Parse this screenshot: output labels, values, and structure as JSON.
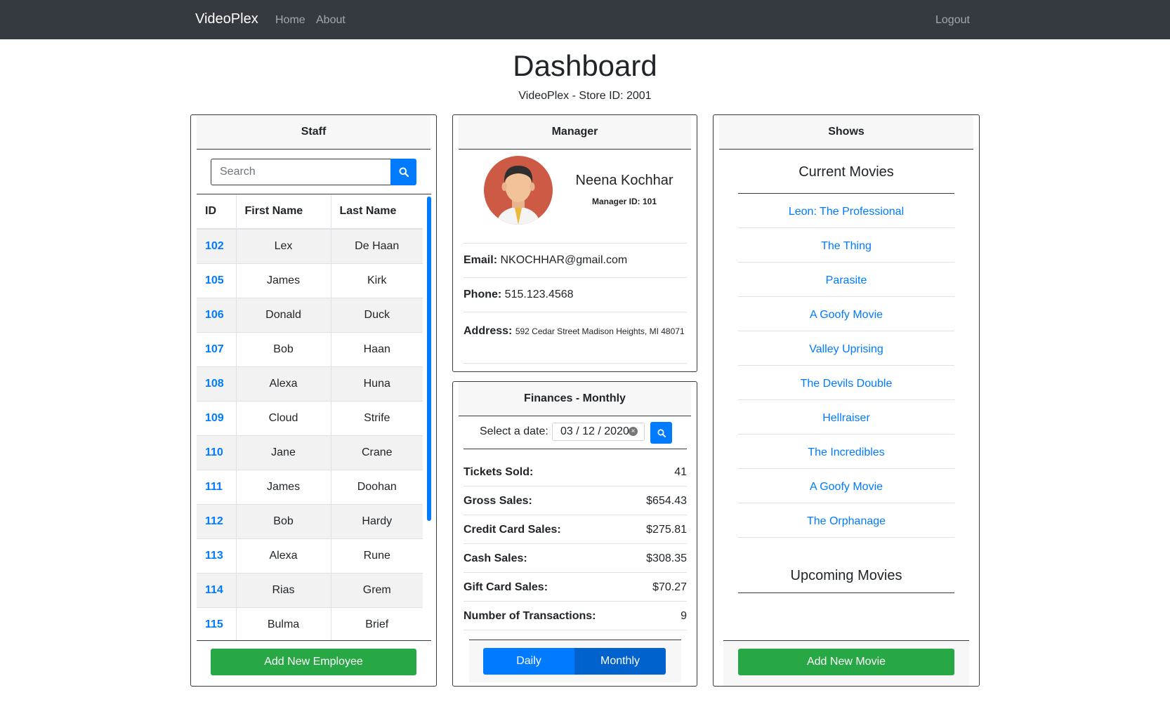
{
  "navbar": {
    "brand": "VideoPlex",
    "home": "Home",
    "about": "About",
    "logout": "Logout"
  },
  "page": {
    "title": "Dashboard",
    "subtitle": "VideoPlex - Store ID: 2001"
  },
  "staff": {
    "header": "Staff",
    "search_placeholder": "Search",
    "columns": [
      "ID",
      "First Name",
      "Last Name"
    ],
    "rows": [
      [
        "102",
        "Lex",
        "De Haan"
      ],
      [
        "105",
        "James",
        "Kirk"
      ],
      [
        "106",
        "Donald",
        "Duck"
      ],
      [
        "107",
        "Bob",
        "Haan"
      ],
      [
        "108",
        "Alexa",
        "Huna"
      ],
      [
        "109",
        "Cloud",
        "Strife"
      ],
      [
        "110",
        "Jane",
        "Crane"
      ],
      [
        "111",
        "James",
        "Doohan"
      ],
      [
        "112",
        "Bob",
        "Hardy"
      ],
      [
        "113",
        "Alexa",
        "Rune"
      ],
      [
        "114",
        "Rias",
        "Grem"
      ],
      [
        "115",
        "Bulma",
        "Brief"
      ]
    ],
    "add_button": "Add New Employee"
  },
  "manager": {
    "header": "Manager",
    "name": "Neena Kochhar",
    "manager_id": "Manager ID: 101",
    "email_label": "Email:",
    "email": "NKOCHHAR@gmail.com",
    "phone_label": "Phone:",
    "phone": "515.123.4568",
    "address_label": "Address:",
    "address": "592 Cedar Street Madison Heights, MI 48071"
  },
  "finances": {
    "header": "Finances - Monthly",
    "date_label": "Select a date:",
    "date_value": "03 / 12 / 2020",
    "rows": [
      {
        "label": "Tickets Sold:",
        "value": "41"
      },
      {
        "label": "Gross Sales:",
        "value": "$654.43"
      },
      {
        "label": "Credit Card Sales:",
        "value": "$275.81"
      },
      {
        "label": "Cash Sales:",
        "value": "$308.35"
      },
      {
        "label": "Gift Card Sales:",
        "value": "$70.27"
      },
      {
        "label": "Number of Transactions:",
        "value": "9"
      }
    ],
    "toggle_daily": "Daily",
    "toggle_monthly": "Monthly"
  },
  "shows": {
    "header": "Shows",
    "current_title": "Current Movies",
    "current_movies": [
      "Leon: The Professional",
      "The Thing",
      "Parasite",
      "A Goofy Movie",
      "Valley Uprising",
      "The Devils Double",
      "Hellraiser",
      "The Incredibles",
      "A Goofy Movie",
      "The Orphanage"
    ],
    "upcoming_title": "Upcoming Movies",
    "add_button": "Add New Movie"
  },
  "icons": {
    "search": "search-icon",
    "avatar": "manager-avatar",
    "clear": "clear-icon"
  },
  "colors": {
    "primary": "#007bff",
    "success": "#28a745",
    "navbar": "#343a40"
  }
}
